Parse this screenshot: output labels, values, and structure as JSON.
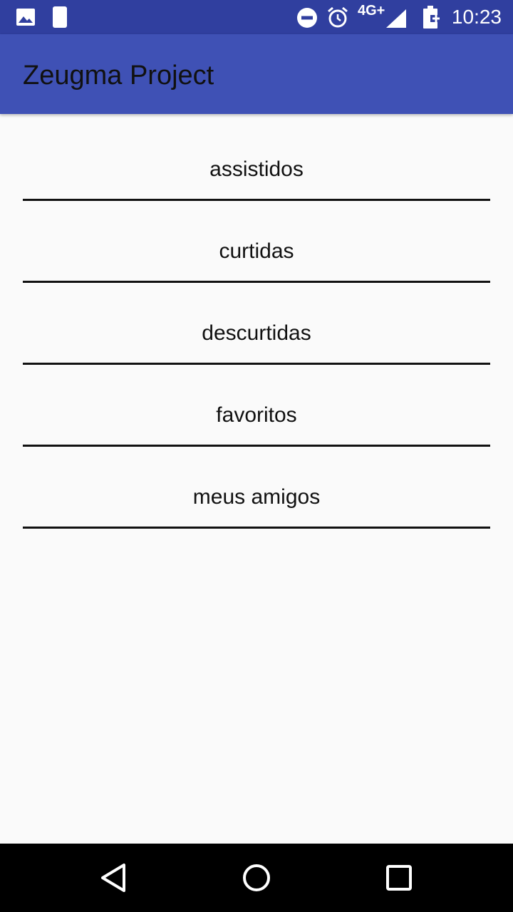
{
  "status_bar": {
    "time": "10:23",
    "network": "4G+",
    "icons": [
      "image-icon",
      "phone-moon-icon",
      "do-not-disturb-icon",
      "alarm-icon",
      "signal-icon",
      "battery-charging-icon"
    ]
  },
  "app_bar": {
    "title": "Zeugma Project"
  },
  "menu": {
    "items": [
      {
        "label": "assistidos"
      },
      {
        "label": "curtidas"
      },
      {
        "label": "descurtidas"
      },
      {
        "label": "favoritos"
      },
      {
        "label": "meus amigos"
      }
    ]
  },
  "nav_bar": {
    "buttons": [
      "back-icon",
      "home-icon",
      "recents-icon"
    ]
  },
  "colors": {
    "status_bar": "#303f9f",
    "app_bar": "#3f51b5",
    "background": "#fafafa",
    "text": "#111111"
  }
}
